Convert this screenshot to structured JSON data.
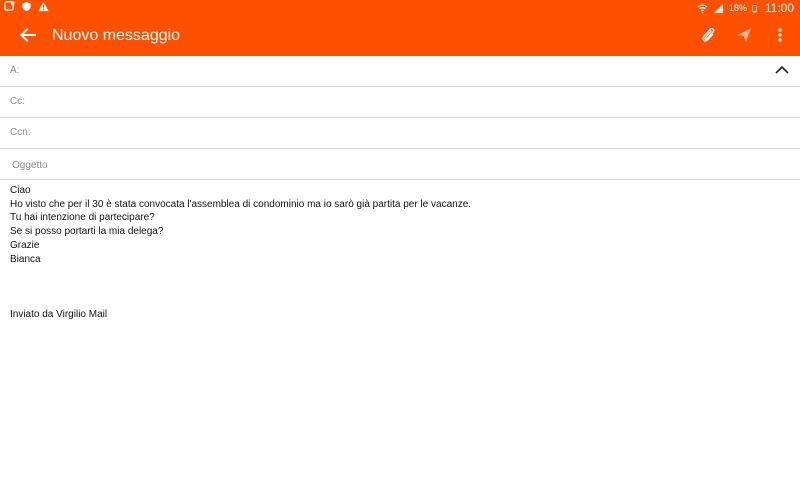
{
  "status_bar": {
    "left_icons": [
      "notification-icon",
      "vpn-shield-icon",
      "warning-icon"
    ],
    "battery": "18%",
    "time": "11:00"
  },
  "app_bar": {
    "title": "Nuovo messaggio",
    "back_icon": "arrow-left-icon",
    "actions": [
      "paperclip-icon",
      "send-icon",
      "more-vert-icon"
    ],
    "color": "#ff5000"
  },
  "fields": {
    "to_label": "A:",
    "to_value": "",
    "cc_label": "Cc:",
    "cc_value": "",
    "bcc_label": "Ccn:",
    "bcc_value": "",
    "subject_placeholder": "Oggetto",
    "subject_value": ""
  },
  "message": {
    "lines": [
      "Ciao",
      "Ho visto che per il 30 è stata convocata l'assemblea di condominio ma io sarò già partita per le vacanze.",
      "Tu hai intenzione di partecipare?",
      "Se si posso portarti la mia delega?",
      "Grazie",
      "Bianca"
    ],
    "signature": "Inviato da Virgilio Mail"
  }
}
